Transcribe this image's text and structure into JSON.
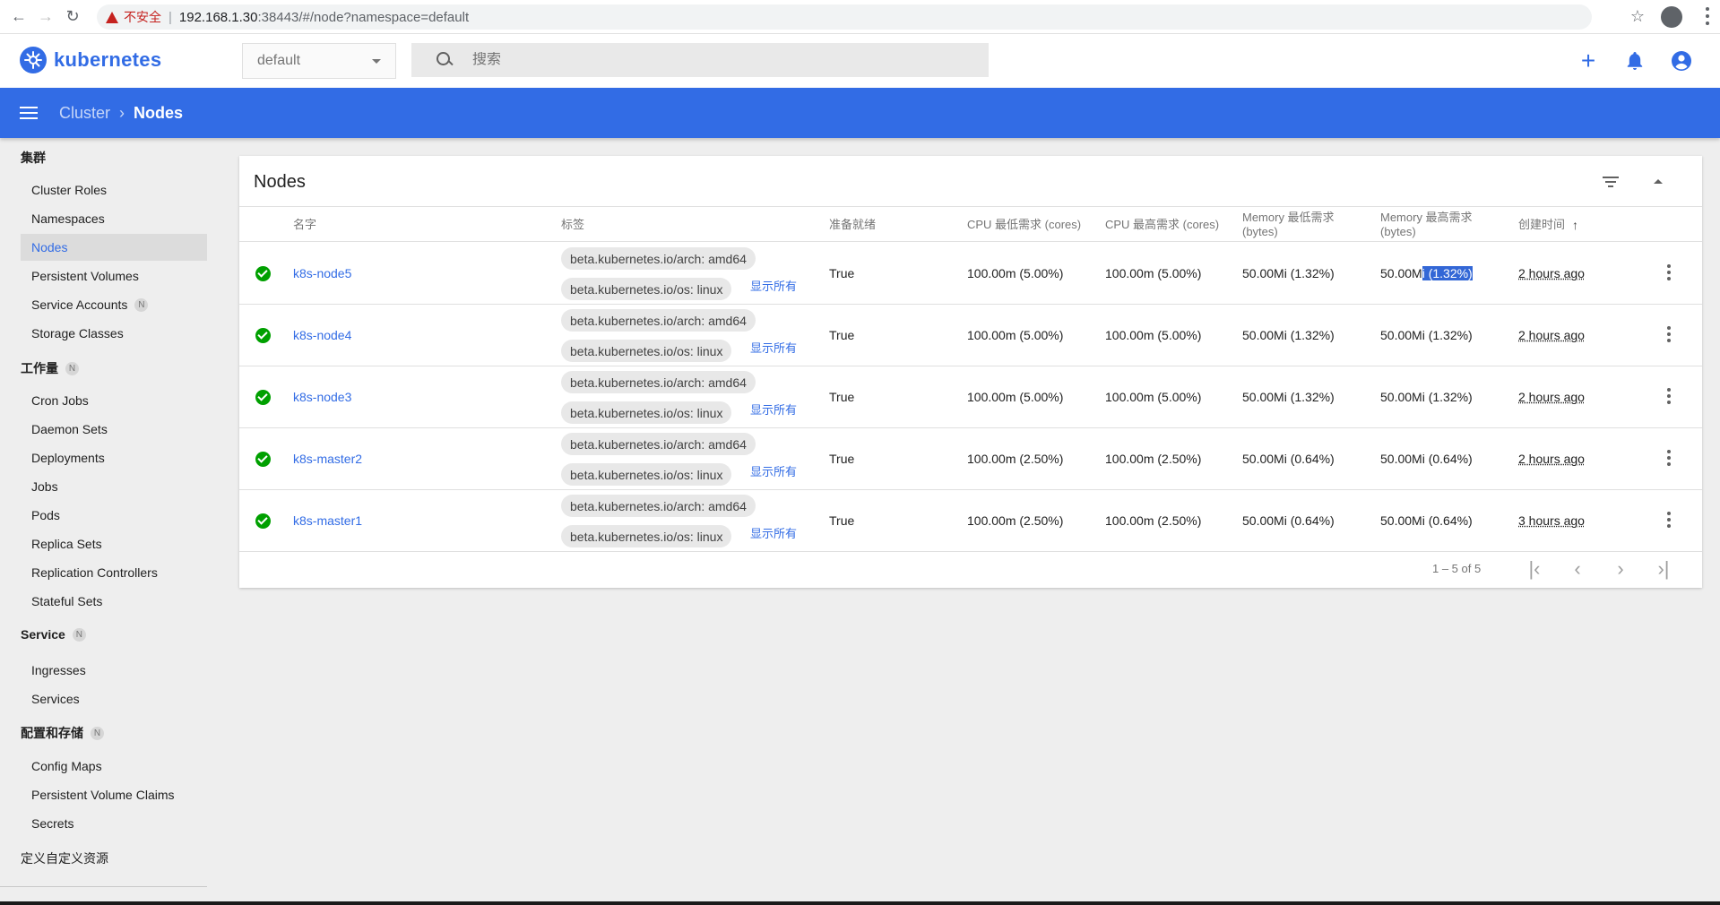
{
  "browser": {
    "security_label": "不安全",
    "url_host": "192.168.1.30",
    "url_rest": ":38443/#/node?namespace=default"
  },
  "header": {
    "logo_text": "kubernetes",
    "namespace": "default",
    "search_placeholder": "搜索"
  },
  "toolbar": {
    "breadcrumb_parent": "Cluster",
    "breadcrumb_current": "Nodes"
  },
  "sidebar": {
    "sections": [
      {
        "title": "集群",
        "badge": ""
      },
      {
        "title": "工作量",
        "badge": "N"
      },
      {
        "title": "Service",
        "badge": "N"
      },
      {
        "title": "配置和存储",
        "badge": "N"
      },
      {
        "title": "定义自定义资源",
        "badge": ""
      }
    ],
    "cluster_items": [
      "Cluster Roles",
      "Namespaces",
      "Nodes",
      "Persistent Volumes",
      "Service Accounts",
      "Storage Classes"
    ],
    "service_accounts_badge": "N",
    "workload_items": [
      "Cron Jobs",
      "Daemon Sets",
      "Deployments",
      "Jobs",
      "Pods",
      "Replica Sets",
      "Replication Controllers",
      "Stateful Sets"
    ],
    "service_items": [
      "Ingresses",
      "Services"
    ],
    "config_items": [
      "Config Maps",
      "Persistent Volume Claims",
      "Secrets"
    ],
    "active_item": "Nodes"
  },
  "card": {
    "title": "Nodes",
    "columns": {
      "name": "名字",
      "labels": "标签",
      "ready": "准备就绪",
      "cpu_req": "CPU 最低需求 (cores)",
      "cpu_lim": "CPU 最高需求 (cores)",
      "mem_req_1": "Memory 最低需求",
      "mem_req_2": "(bytes)",
      "mem_lim_1": "Memory 最高需求",
      "mem_lim_2": "(bytes)",
      "created": "创建时间"
    },
    "show_all": "显示所有",
    "rows": [
      {
        "name": "k8s-node5",
        "label1": "beta.kubernetes.io/arch: amd64",
        "label2": "beta.kubernetes.io/os: linux",
        "ready": "True",
        "cpu_req": "100.00m (5.00%)",
        "cpu_lim": "100.00m (5.00%)",
        "mem_req": "50.00Mi (1.32%)",
        "mem_lim_a": "50.00M",
        "mem_lim_b": "i (1.32%)",
        "age": "2 hours ago"
      },
      {
        "name": "k8s-node4",
        "label1": "beta.kubernetes.io/arch: amd64",
        "label2": "beta.kubernetes.io/os: linux",
        "ready": "True",
        "cpu_req": "100.00m (5.00%)",
        "cpu_lim": "100.00m (5.00%)",
        "mem_req": "50.00Mi (1.32%)",
        "mem_lim": "50.00Mi (1.32%)",
        "age": "2 hours ago"
      },
      {
        "name": "k8s-node3",
        "label1": "beta.kubernetes.io/arch: amd64",
        "label2": "beta.kubernetes.io/os: linux",
        "ready": "True",
        "cpu_req": "100.00m (5.00%)",
        "cpu_lim": "100.00m (5.00%)",
        "mem_req": "50.00Mi (1.32%)",
        "mem_lim": "50.00Mi (1.32%)",
        "age": "2 hours ago"
      },
      {
        "name": "k8s-master2",
        "label1": "beta.kubernetes.io/arch: amd64",
        "label2": "beta.kubernetes.io/os: linux",
        "ready": "True",
        "cpu_req": "100.00m (2.50%)",
        "cpu_lim": "100.00m (2.50%)",
        "mem_req": "50.00Mi (0.64%)",
        "mem_lim": "50.00Mi (0.64%)",
        "age": "2 hours ago"
      },
      {
        "name": "k8s-master1",
        "label1": "beta.kubernetes.io/arch: amd64",
        "label2": "beta.kubernetes.io/os: linux",
        "ready": "True",
        "cpu_req": "100.00m (2.50%)",
        "cpu_lim": "100.00m (2.50%)",
        "mem_req": "50.00Mi (0.64%)",
        "mem_lim": "50.00Mi (0.64%)",
        "age": "3 hours ago"
      }
    ],
    "pager_range": "1 – 5 of 5"
  },
  "colors": {
    "brand": "#326ce5",
    "ready": "#00a000"
  },
  "icons": [
    "back-icon",
    "forward-icon",
    "reload-icon",
    "warning-icon",
    "star-icon",
    "account-icon",
    "browser-menu-icon",
    "kubernetes-logo-icon",
    "search-icon",
    "plus-icon",
    "bell-icon",
    "user-icon",
    "hamburger-icon",
    "chevron-right-icon",
    "filter-icon",
    "collapse-icon",
    "check-circle-icon",
    "more-vert-icon",
    "first-page-icon",
    "prev-page-icon",
    "next-page-icon",
    "last-page-icon"
  ]
}
